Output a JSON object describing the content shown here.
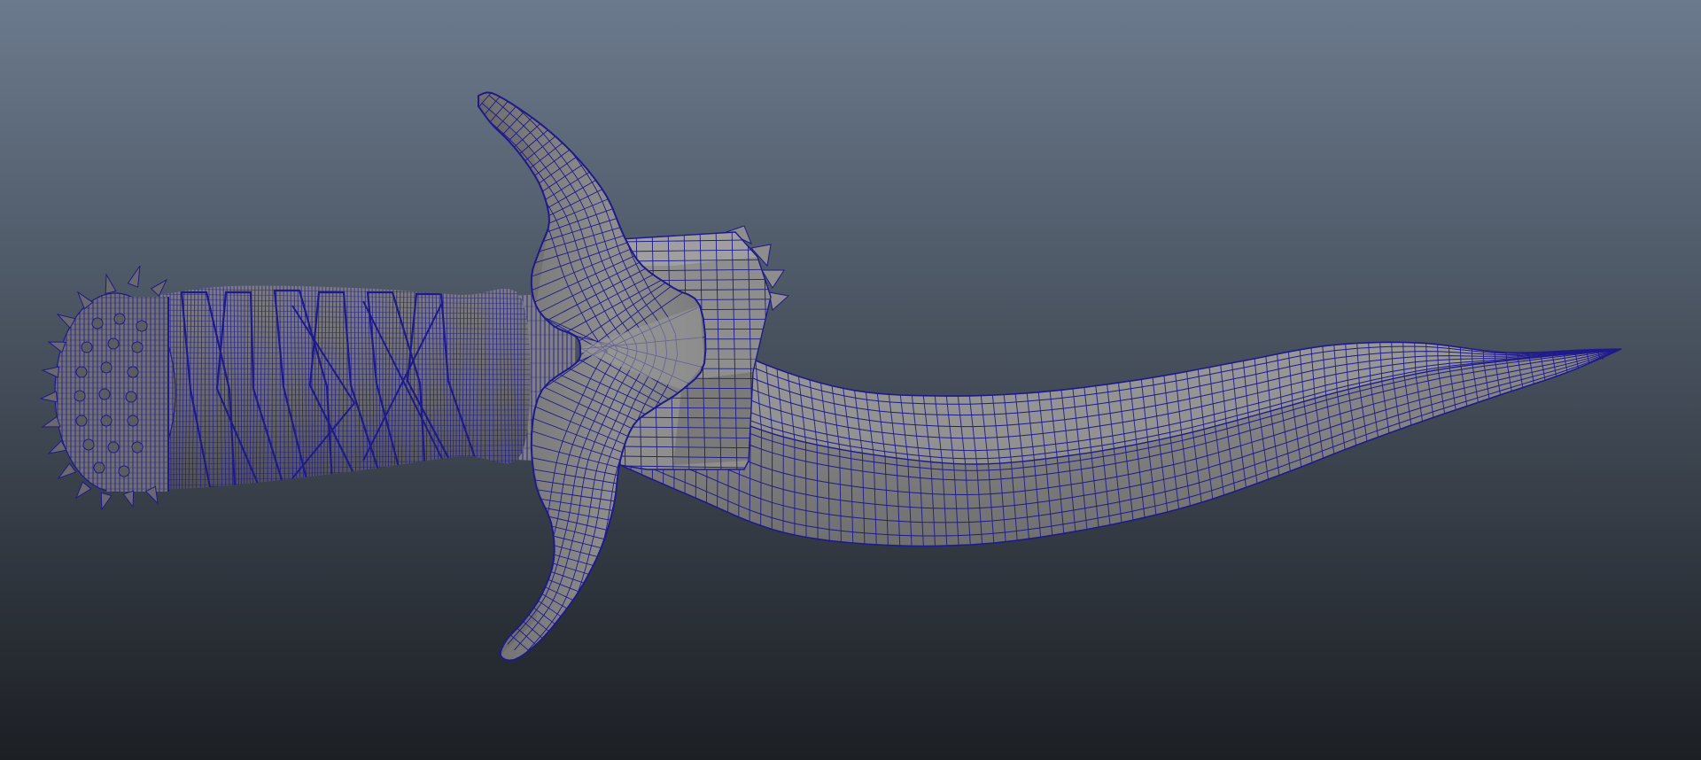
{
  "viewport": {
    "background_top": "#6b7a8d",
    "background_bottom": "#1c1f24",
    "model": {
      "name": "serrated dagger",
      "display_mode": "wireframe-on-shaded",
      "shaded_color": "#8c8c8c",
      "wire_color": "#1e1a8c"
    }
  }
}
